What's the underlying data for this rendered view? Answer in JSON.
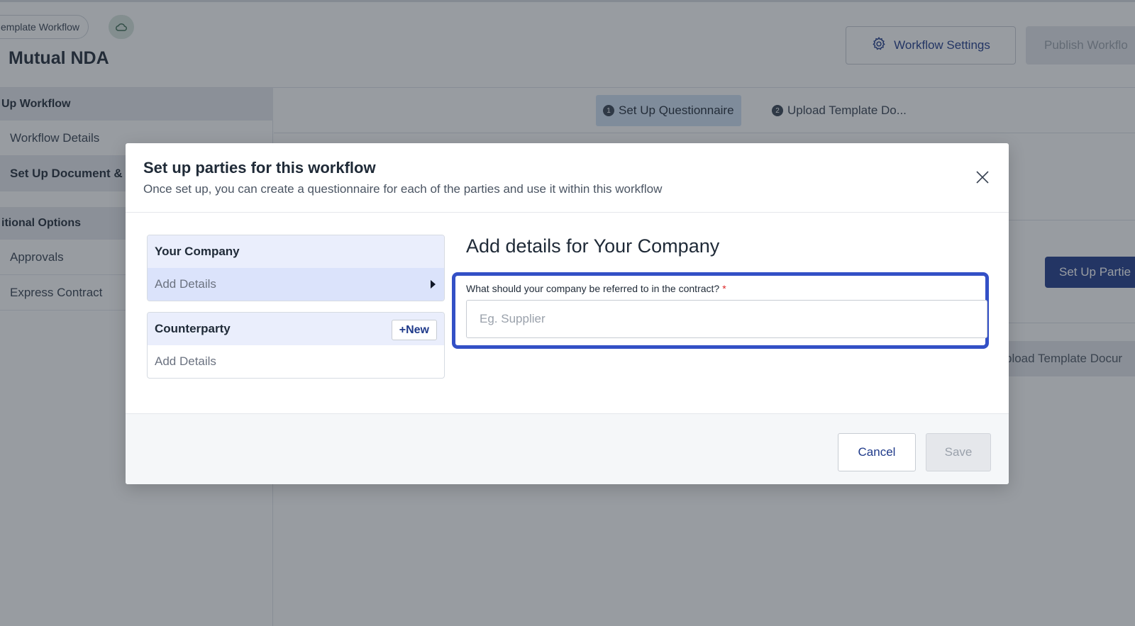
{
  "app": {
    "template_chip": "emplate Workflow",
    "page_title": "Mutual NDA",
    "workflow_settings_label": "Workflow Settings",
    "publish_label": "Publish Workflo",
    "sidebar": {
      "section_setup": "Up Workflow",
      "items": [
        "Workflow Details",
        "Set Up Document &"
      ],
      "section_additional": "itional Options",
      "extra_items": [
        "Approvals",
        "Express Contract"
      ]
    },
    "steps": [
      {
        "num": "1",
        "label": "Set Up Questionnaire"
      },
      {
        "num": "2",
        "label": "Upload Template Do..."
      }
    ],
    "setup_parties_label": "Set Up Partie",
    "upload_template_label": "pload Template Docur"
  },
  "modal": {
    "title": "Set up parties for this workflow",
    "subtitle": "Once set up, you can create a questionnaire for each of the parties and use it within this workflow",
    "parties": [
      {
        "name": "Your Company",
        "row": "Add Details"
      },
      {
        "name": "Counterparty",
        "row": "Add Details",
        "new_label": "+New"
      }
    ],
    "details_heading": "Add details for Your Company",
    "field": {
      "label": "What should your company be referred to in the contract?",
      "required_mark": "*",
      "placeholder": "Eg. Supplier",
      "value": ""
    },
    "cancel_label": "Cancel",
    "save_label": "Save"
  },
  "colors": {
    "primary": "#1f3a8a",
    "focus_ring": "#3350c6",
    "required": "#dc2626"
  }
}
